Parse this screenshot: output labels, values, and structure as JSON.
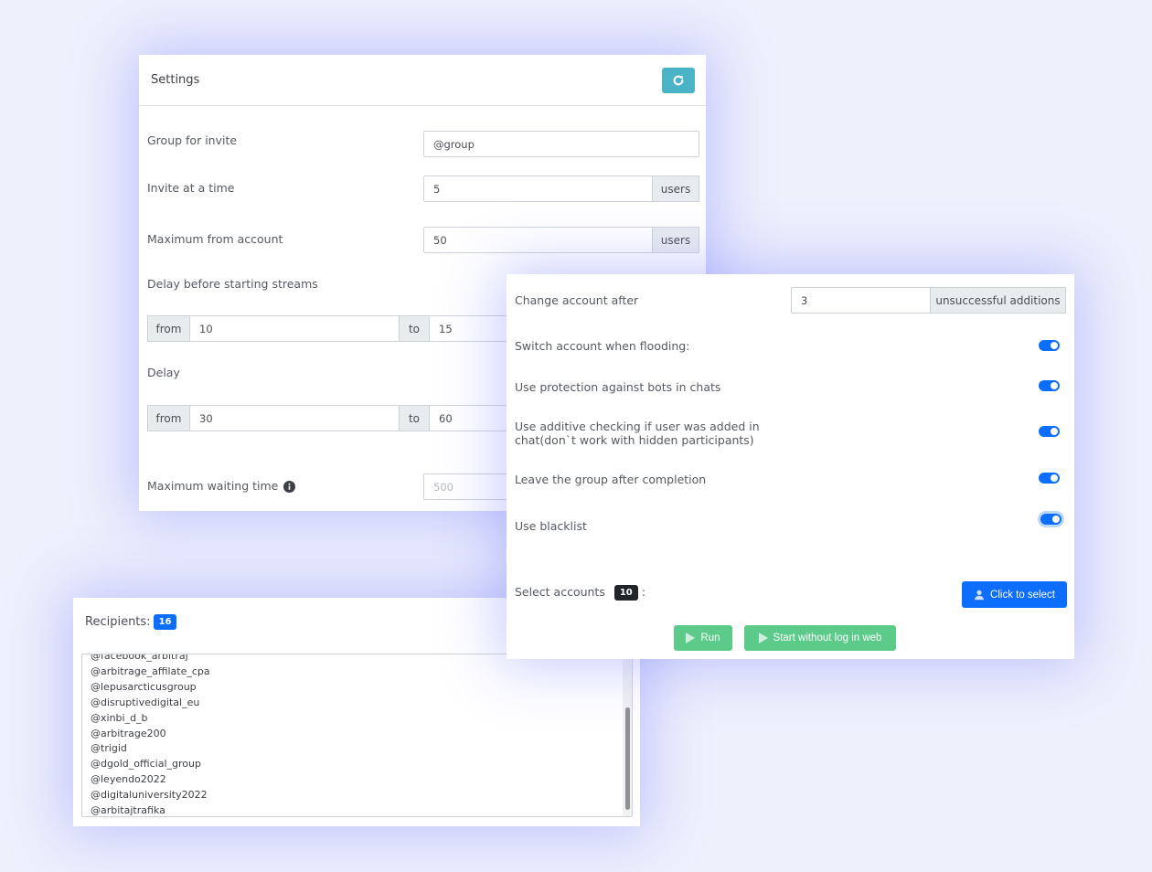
{
  "settings": {
    "title": "Settings",
    "group_label": "Group for invite",
    "group_value": "@group",
    "invite_label": "Invite at a time",
    "invite_value": "5",
    "invite_addon": "users",
    "max_account_label": "Maximum from account",
    "max_account_value": "50",
    "max_account_addon": "users",
    "streams_label": "Delay before starting streams",
    "streams_from_label": "from",
    "streams_from_value": "10",
    "streams_to_label": "to",
    "streams_to_value": "15",
    "delay_label": "Delay",
    "delay_from_label": "from",
    "delay_from_value": "30",
    "delay_to_label": "to",
    "delay_to_value": "60",
    "max_wait_label": "Maximum waiting time",
    "max_wait_placeholder": "500"
  },
  "options": {
    "change_account_label": "Change account after",
    "change_account_value": "3",
    "change_account_addon": "unsuccessful additions",
    "switch_flood_label": "Switch account when flooding:",
    "bot_protection_label": "Use protection against bots in chats",
    "additive_check_line1": "Use additive checking if user was added in",
    "additive_check_line2": "chat(don`t work with hidden participants)",
    "leave_group_label": "Leave the group after completion",
    "blacklist_label": "Use blacklist",
    "toggles_on": [
      true,
      true,
      true,
      true,
      true
    ],
    "select_accounts_label": "Select accounts",
    "select_accounts_count": "10",
    "select_accounts_colon": ":",
    "click_select_label": "Click to select",
    "run_label": "Run",
    "start_web_label": "Start without log in web"
  },
  "recipients": {
    "label": "Recipients:",
    "count": "16",
    "items": [
      "@facebook_arbitraj",
      "@arbitrage_affilate_cpa",
      "@lepusarcticusgroup",
      "@disruptivedigital_eu",
      "@xinbi_d_b",
      "@arbitrage200",
      "@trigid",
      "@dgold_official_group",
      "@leyendo2022",
      "@digitaluniversity2022",
      "@arbitajtrafika"
    ]
  },
  "colors": {
    "primary": "#0d6efd",
    "refresh": "#4bb3c6",
    "success": "#5ccb8a",
    "background": "#eef0fc"
  }
}
